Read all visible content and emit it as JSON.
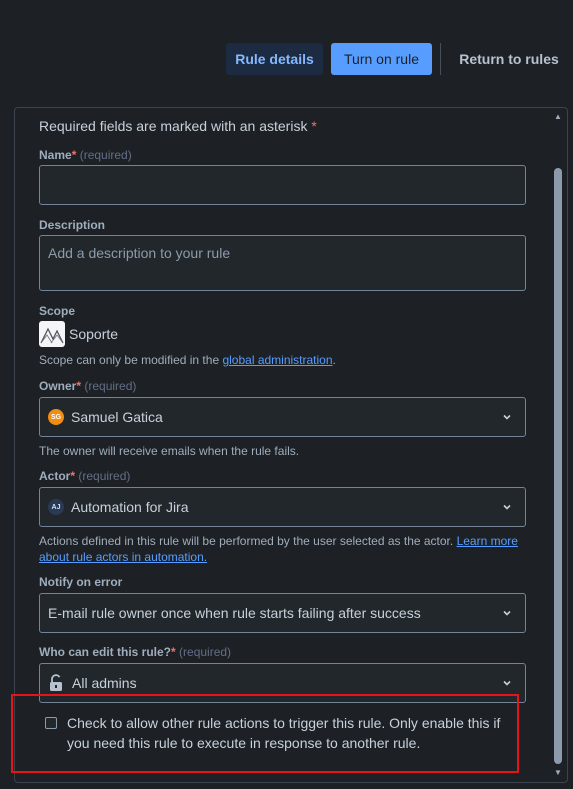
{
  "header": {
    "rule_details_label": "Rule details",
    "turn_on_label": "Turn on rule",
    "return_label": "Return to rules"
  },
  "form": {
    "required_note": "Required fields are marked with an asterisk",
    "asterisk": "*",
    "required_tag": "(required)",
    "name": {
      "label": "Name",
      "value": ""
    },
    "description": {
      "label": "Description",
      "placeholder": "Add a description to your rule"
    },
    "scope": {
      "label": "Scope",
      "value": "Soporte",
      "helper_prefix": "Scope can only be modified in the ",
      "helper_link": "global administration",
      "helper_suffix": "."
    },
    "owner": {
      "label": "Owner",
      "value": "Samuel Gatica",
      "avatar_initials": "SG",
      "helper": "The owner will receive emails when the rule fails."
    },
    "actor": {
      "label": "Actor",
      "value": "Automation for Jira",
      "avatar_initials": "AJ",
      "helper_prefix": "Actions defined in this rule will be performed by the user selected as the actor. ",
      "helper_link_1": "Learn more",
      "helper_link_2": "about rule actors in automation."
    },
    "notify": {
      "label": "Notify on error",
      "value": "E-mail rule owner once when rule starts failing after success"
    },
    "who_can_edit": {
      "label": "Who can edit this rule?",
      "value": "All admins",
      "icon": "unlock-icon"
    },
    "allow_trigger": {
      "checked": false,
      "line1": "Check to allow other rule actions to trigger this rule. Only enable this if",
      "line2": "you need this rule to execute in response to another rule."
    }
  },
  "colors": {
    "background": "#1d2125",
    "primary_button": "#579dff",
    "highlight_border": "#e5141a",
    "required_star": "#f87168"
  }
}
